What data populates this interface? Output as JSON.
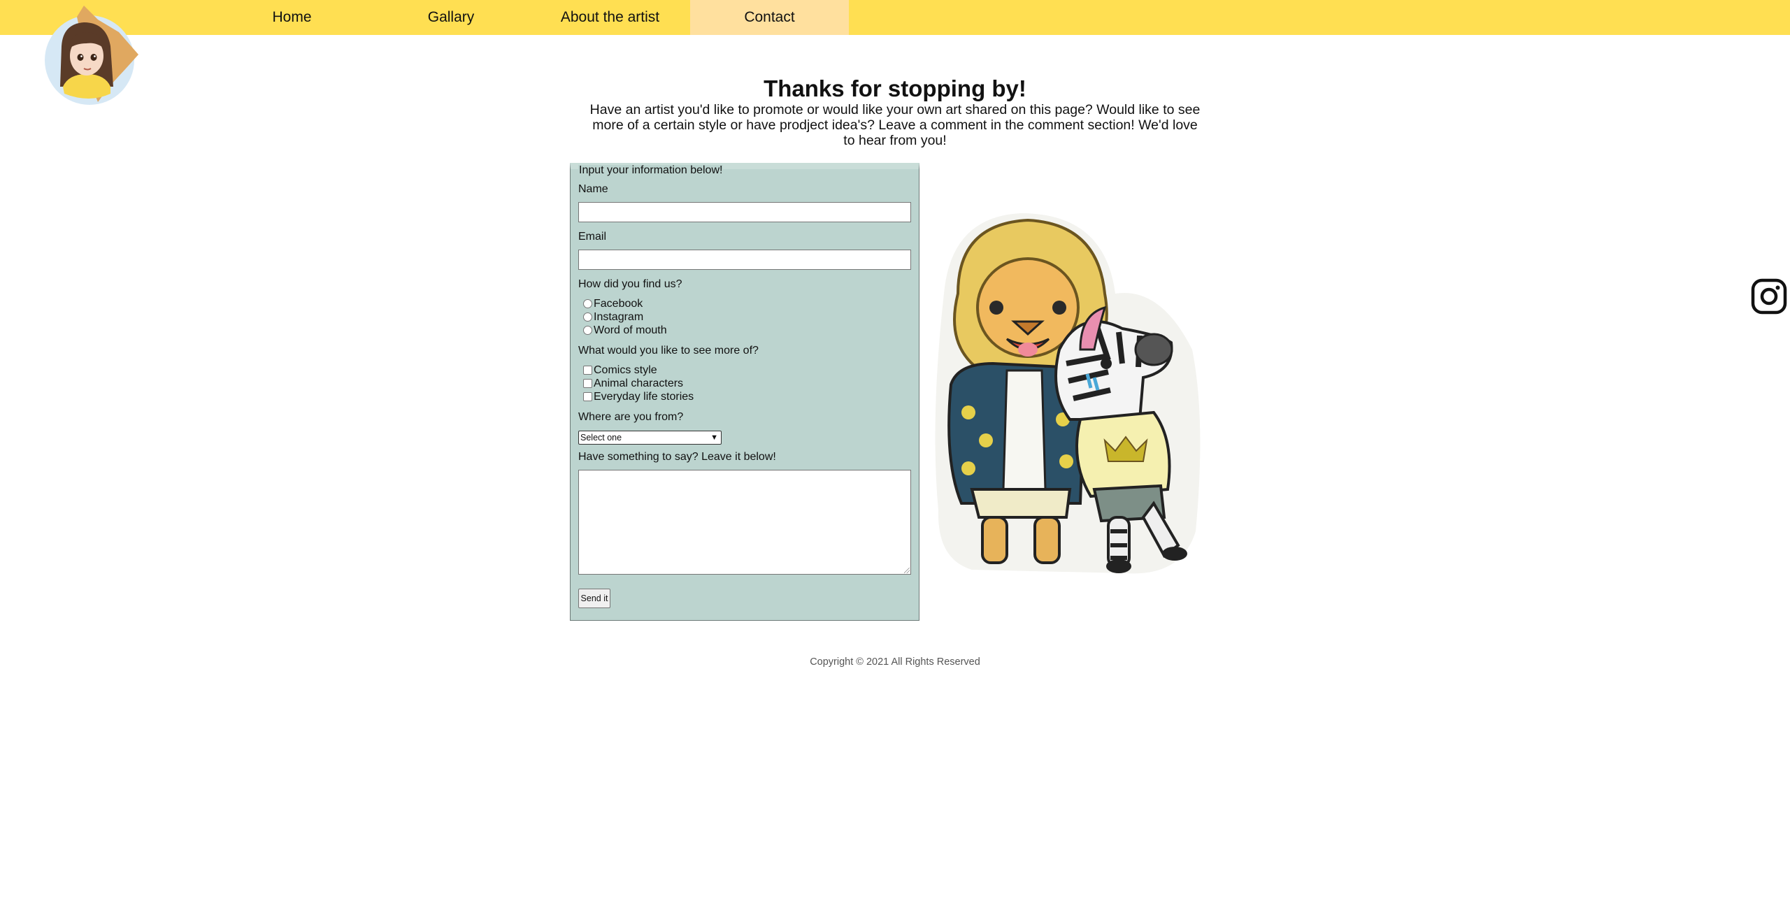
{
  "nav": {
    "items": [
      {
        "label": "Home"
      },
      {
        "label": "Gallary"
      },
      {
        "label": "About the artist"
      },
      {
        "label": "Contact"
      }
    ]
  },
  "header": {
    "title": "Thanks for stopping by!",
    "intro": "Have an artist you'd like to promote or would like your own art shared on this page? Would like to see more of a certain style or have prodject idea's? Leave a comment in the comment section! We'd love to hear from you!"
  },
  "form": {
    "legend": "Input your information below!",
    "name_label": "Name",
    "name_value": "",
    "email_label": "Email",
    "email_value": "",
    "find_label": "How did you find us?",
    "find_options": [
      "Facebook",
      "Instagram",
      "Word of mouth"
    ],
    "more_label": "What would you like to see more of?",
    "more_options": [
      "Comics style",
      "Animal characters",
      "Everyday life stories"
    ],
    "from_label": "Where are you from?",
    "from_selected": "Select one",
    "say_label": "Have something to say? Leave it below!",
    "say_value": "",
    "send_label": "Send it"
  },
  "footer": {
    "copyright": "Copyright © 2021 All Rights Reserved"
  },
  "icons": {
    "social": "instagram-icon",
    "logo": "artist-avatar-logo",
    "illustration": "lion-and-zebra-sticker"
  },
  "colors": {
    "nav_bg": "#ffdf52",
    "nav_active": "#ffe09e",
    "form_bg": "#bcd4cf"
  }
}
